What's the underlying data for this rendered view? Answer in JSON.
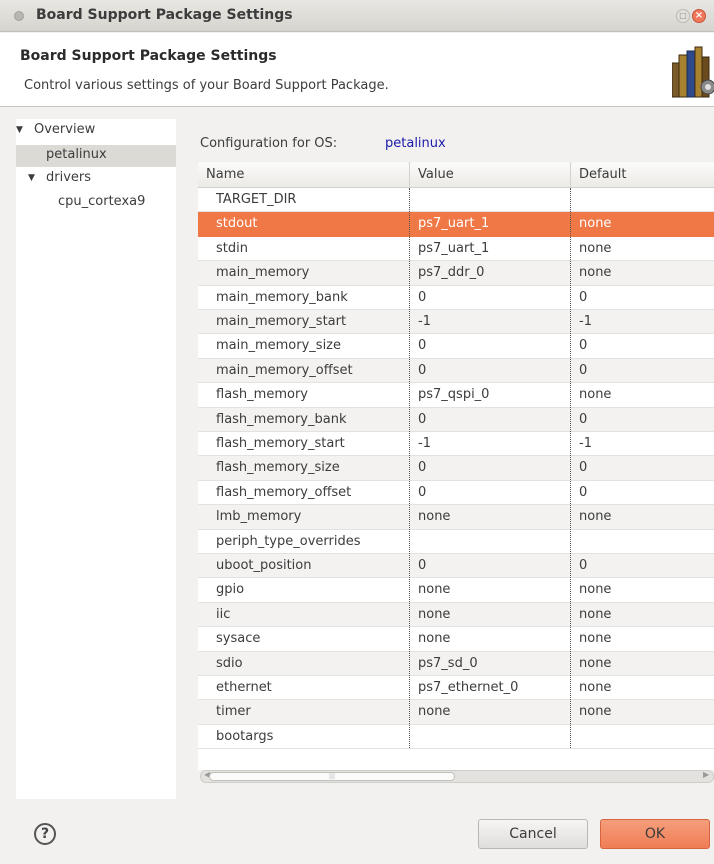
{
  "window": {
    "title": "Board Support Package Settings"
  },
  "header": {
    "title": "Board Support Package Settings",
    "description": "Control various settings of your Board Support Package."
  },
  "tree": {
    "items": [
      {
        "label": "Overview",
        "expanded": true
      },
      {
        "label": "petalinux",
        "selected": true
      },
      {
        "label": "drivers",
        "expanded": true
      },
      {
        "label": "cpu_cortexa9"
      }
    ]
  },
  "config": {
    "label": "Configuration for OS:",
    "os": "petalinux"
  },
  "table": {
    "columns": [
      "Name",
      "Value",
      "Default"
    ],
    "selected_row": 1,
    "rows": [
      {
        "name": "TARGET_DIR",
        "value": "",
        "default": ""
      },
      {
        "name": "stdout",
        "value": "ps7_uart_1",
        "default": "none"
      },
      {
        "name": "stdin",
        "value": "ps7_uart_1",
        "default": "none"
      },
      {
        "name": "main_memory",
        "value": "ps7_ddr_0",
        "default": "none"
      },
      {
        "name": "main_memory_bank",
        "value": "0",
        "default": "0"
      },
      {
        "name": "main_memory_start",
        "value": "-1",
        "default": "-1"
      },
      {
        "name": "main_memory_size",
        "value": "0",
        "default": "0"
      },
      {
        "name": "main_memory_offset",
        "value": "0",
        "default": "0"
      },
      {
        "name": "flash_memory",
        "value": "ps7_qspi_0",
        "default": "none"
      },
      {
        "name": "flash_memory_bank",
        "value": "0",
        "default": "0"
      },
      {
        "name": "flash_memory_start",
        "value": "-1",
        "default": "-1"
      },
      {
        "name": "flash_memory_size",
        "value": "0",
        "default": "0"
      },
      {
        "name": "flash_memory_offset",
        "value": "0",
        "default": "0"
      },
      {
        "name": "lmb_memory",
        "value": "none",
        "default": "none"
      },
      {
        "name": "periph_type_overrides",
        "value": "",
        "default": ""
      },
      {
        "name": "uboot_position",
        "value": "0",
        "default": "0"
      },
      {
        "name": "gpio",
        "value": "none",
        "default": "none"
      },
      {
        "name": "iic",
        "value": "none",
        "default": "none"
      },
      {
        "name": "sysace",
        "value": "none",
        "default": "none"
      },
      {
        "name": "sdio",
        "value": "ps7_sd_0",
        "default": "none"
      },
      {
        "name": "ethernet",
        "value": "ps7_ethernet_0",
        "default": "none"
      },
      {
        "name": "timer",
        "value": "none",
        "default": "none"
      },
      {
        "name": "bootargs",
        "value": "",
        "default": ""
      }
    ]
  },
  "footer": {
    "cancel_label": "Cancel",
    "ok_label": "OK"
  },
  "colors": {
    "selection": "#f07746",
    "ok_button": "#f07d55",
    "os_link": "#1a1aaa"
  }
}
